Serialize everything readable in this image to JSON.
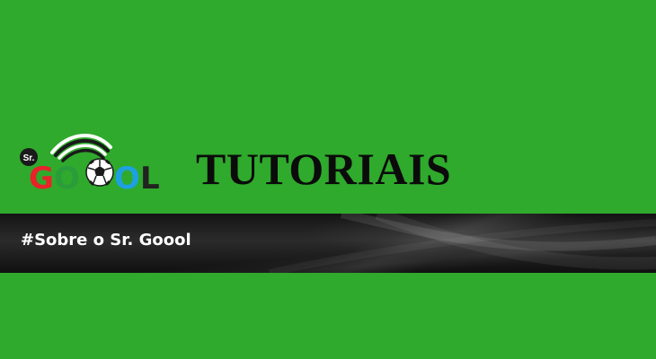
{
  "logo": {
    "prefix": "Sr.",
    "letters": [
      "G",
      "O",
      "O",
      "L"
    ],
    "icon": "soccer-ball-icon",
    "colors": {
      "G": "#e8232a",
      "O1": "#2a9d3a",
      "O2": "#1ea0e0",
      "L": "#222222"
    }
  },
  "header": {
    "title": "TUTORIAIS"
  },
  "banner": {
    "text": "#Sobre o Sr. Goool"
  },
  "colors": {
    "background": "#2faa2c",
    "title": "#0b0b0b",
    "banner": "#1c1c1c",
    "banner_text": "#ffffff"
  }
}
